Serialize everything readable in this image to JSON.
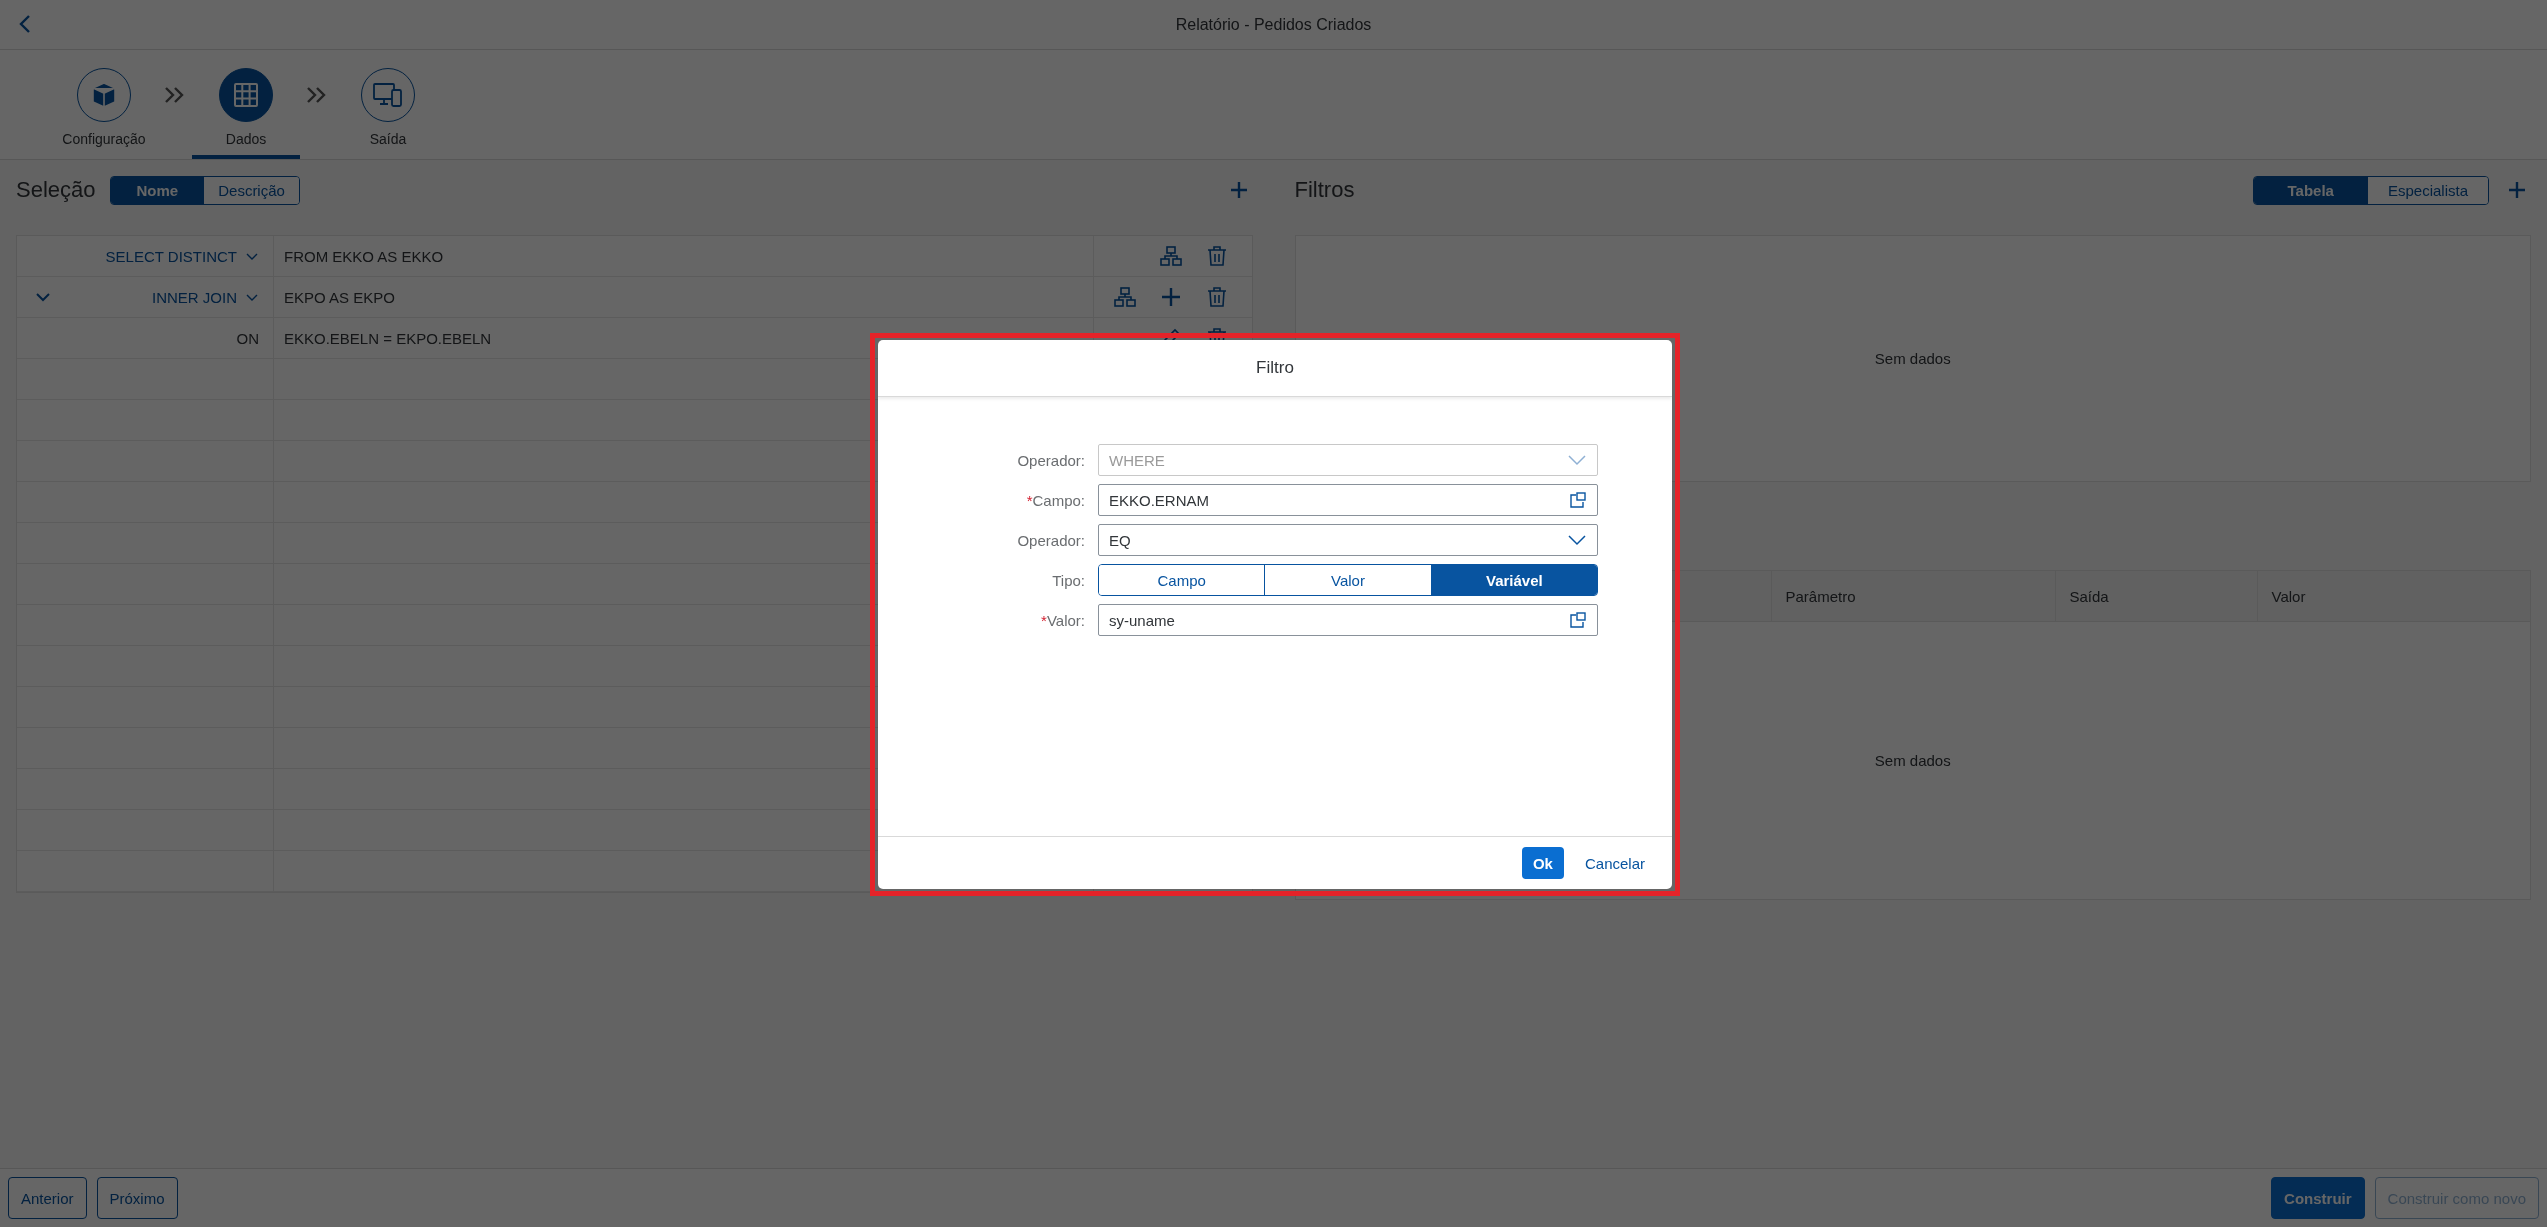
{
  "header": {
    "title": "Relatório - Pedidos Criados"
  },
  "steps": [
    {
      "label": "Configuração",
      "kind": "config",
      "selected": false
    },
    {
      "label": "Dados",
      "kind": "data",
      "selected": true
    },
    {
      "label": "Saída",
      "kind": "output",
      "selected": false
    }
  ],
  "selection": {
    "title": "Seleção",
    "view_toggle": [
      {
        "label": "Nome",
        "selected": true
      },
      {
        "label": "Descrição",
        "selected": false
      }
    ],
    "rows": [
      {
        "expandable": false,
        "keyword": "SELECT DISTINCT",
        "dropdown": true,
        "value": "FROM EKKO AS EKKO",
        "actions": [
          {
            "kind": "hierarchy"
          },
          {
            "kind": "delete"
          }
        ]
      },
      {
        "expandable": true,
        "keyword": "INNER JOIN",
        "dropdown": true,
        "value": "EKPO AS EKPO",
        "actions": [
          {
            "kind": "hierarchy"
          },
          {
            "kind": "add"
          },
          {
            "kind": "delete"
          }
        ]
      },
      {
        "expandable": false,
        "keyword": "ON",
        "dropdown": false,
        "value": "EKKO.EBELN = EKPO.EBELN",
        "actions": [
          {
            "kind": "edit"
          },
          {
            "kind": "delete"
          }
        ]
      }
    ]
  },
  "filters": {
    "title": "Filtros",
    "view_toggle": [
      {
        "label": "Tabela",
        "selected": true
      },
      {
        "label": "Especialista",
        "selected": false
      }
    ],
    "empty_text": "Sem dados"
  },
  "parameters": {
    "columns": [
      "Parâmetro",
      "Saída",
      "Valor"
    ],
    "empty_text": "Sem dados"
  },
  "dialog": {
    "title": "Filtro",
    "required_marker": "*",
    "fields": [
      {
        "label": "Operador:",
        "kind": "select",
        "value": "WHERE",
        "disabled": true,
        "required": false
      },
      {
        "label": "Campo:",
        "kind": "valuehelp",
        "value": "EKKO.ERNAM",
        "disabled": false,
        "required": true
      },
      {
        "label": "Operador:",
        "kind": "select",
        "value": "EQ",
        "disabled": false,
        "required": false
      },
      {
        "label": "Tipo:",
        "kind": "segmented",
        "required": false,
        "options": [
          {
            "label": "Campo",
            "selected": false
          },
          {
            "label": "Valor",
            "selected": false
          },
          {
            "label": "Variável",
            "selected": true
          }
        ]
      },
      {
        "label": "Valor:",
        "kind": "valuehelp",
        "value": "sy-uname",
        "disabled": false,
        "required": true
      }
    ],
    "buttons": [
      {
        "label": "Ok",
        "kind": "emphasized"
      },
      {
        "label": "Cancelar",
        "kind": "transparent"
      }
    ]
  },
  "footer": {
    "left_buttons": [
      {
        "label": "Anterior",
        "kind": "default",
        "disabled": false
      },
      {
        "label": "Próximo",
        "kind": "default",
        "disabled": false
      }
    ],
    "right_buttons": [
      {
        "label": "Construir",
        "kind": "emphasized",
        "disabled": false
      },
      {
        "label": "Construir como novo",
        "kind": "default",
        "disabled": true
      }
    ]
  }
}
